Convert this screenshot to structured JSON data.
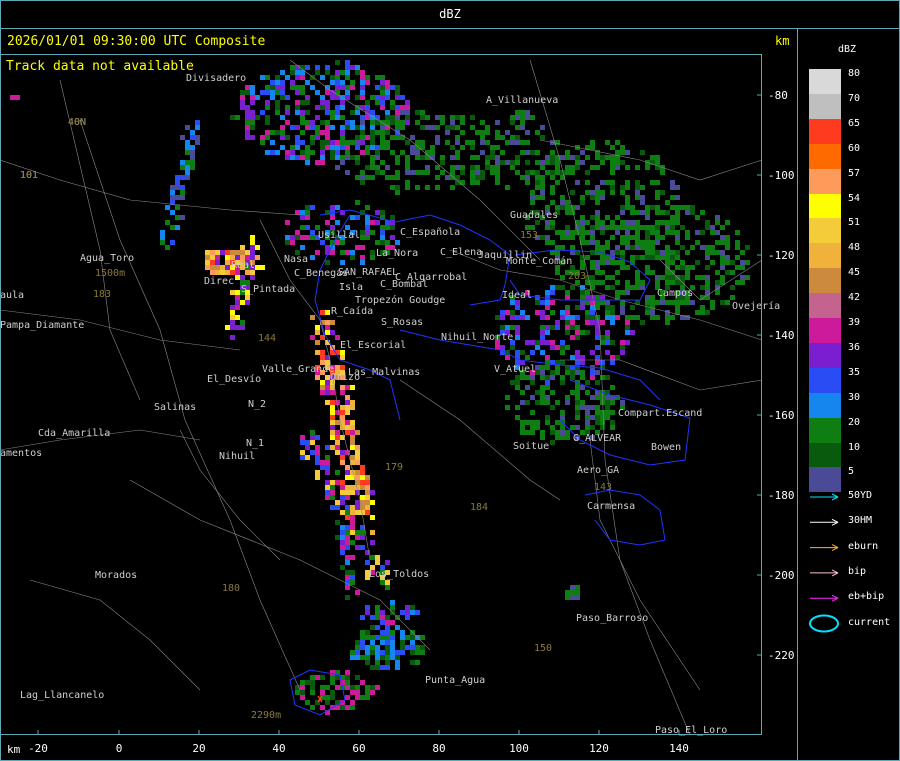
{
  "title": "dBZ",
  "header": {
    "timestamp": "2026/01/01 09:30:00 UTC Composite",
    "track_status": "Track data not available",
    "km_label_top": "km",
    "km_label_bottom": "km"
  },
  "axes": {
    "x_ticks": [
      "-20",
      "0",
      "20",
      "40",
      "60",
      "80",
      "100",
      "120",
      "140"
    ],
    "y_ticks": [
      "-80",
      "-100",
      "-120",
      "-140",
      "-160",
      "-180",
      "-200",
      "-220"
    ]
  },
  "legend": {
    "title": "dBZ",
    "levels": [
      {
        "label": "80",
        "color": "#d9d9d9"
      },
      {
        "label": "70",
        "color": "#bfbfbf"
      },
      {
        "label": "65",
        "color": "#ff3b1f"
      },
      {
        "label": "60",
        "color": "#ff6a00"
      },
      {
        "label": "57",
        "color": "#ff9b5a"
      },
      {
        "label": "54",
        "color": "#ffff00"
      },
      {
        "label": "51",
        "color": "#f4cc3a"
      },
      {
        "label": "48",
        "color": "#f0b23a"
      },
      {
        "label": "45",
        "color": "#cc8a3c"
      },
      {
        "label": "42",
        "color": "#c4648e"
      },
      {
        "label": "39",
        "color": "#cc1a9a"
      },
      {
        "label": "36",
        "color": "#7a1fd0"
      },
      {
        "label": "35",
        "color": "#2a4cf5"
      },
      {
        "label": "30",
        "color": "#1486ee"
      },
      {
        "label": "20",
        "color": "#0e7e12"
      },
      {
        "label": "10",
        "color": "#0a5a0e"
      },
      {
        "label": "5",
        "color": "#4a4a96"
      }
    ],
    "tracks": [
      {
        "label": "50YD",
        "color": "#00e5ff"
      },
      {
        "label": "30HM",
        "color": "#ffffff"
      },
      {
        "label": "eburn",
        "color": "#ffb23a"
      },
      {
        "label": "bip",
        "color": "#ffc0cb"
      },
      {
        "label": "eb+bip",
        "color": "#ff2bff"
      },
      {
        "label": "current",
        "color": "#00e5ff"
      }
    ]
  },
  "places": [
    {
      "name": "Divisadero"
    },
    {
      "name": "A_Villanueva"
    },
    {
      "name": "40N"
    },
    {
      "name": "101"
    },
    {
      "name": "Guadales"
    },
    {
      "name": "Usillal"
    },
    {
      "name": "Monte_Comán"
    },
    {
      "name": "C_Española"
    },
    {
      "name": "La_Nora"
    },
    {
      "name": "C_Elena"
    },
    {
      "name": "Jaquillin"
    },
    {
      "name": "Agua_Toro"
    },
    {
      "name": "C_Benegas"
    },
    {
      "name": "SAN_RAFAEL"
    },
    {
      "name": "C_Algarrobal"
    },
    {
      "name": "C_Bombal"
    },
    {
      "name": "S_Pintada"
    },
    {
      "name": "Tropezón Goudge"
    },
    {
      "name": "Ovejería"
    },
    {
      "name": "R_Caída"
    },
    {
      "name": "S_Rosas"
    },
    {
      "name": "Pampa_Diamante"
    },
    {
      "name": "Nihuil_Norte"
    },
    {
      "name": "El_Escorial"
    },
    {
      "name": "El_Desvío"
    },
    {
      "name": "Valle_Grande"
    },
    {
      "name": "Las_Malvinas"
    },
    {
      "name": "V_Atuel"
    },
    {
      "name": "Salinas"
    },
    {
      "name": "Cda_Amarilla"
    },
    {
      "name": "Compart.Escand"
    },
    {
      "name": "Soitue"
    },
    {
      "name": "G_ALVEAR"
    },
    {
      "name": "Bowen"
    },
    {
      "name": "Nihuil"
    },
    {
      "name": "Aero_GA"
    },
    {
      "name": "Carmensa"
    },
    {
      "name": "Morados"
    },
    {
      "name": "Los_Toldos"
    },
    {
      "name": "Paso_Barroso"
    },
    {
      "name": "Punta_Agua"
    },
    {
      "name": "Lag_Llancanelo"
    },
    {
      "name": "Paso_El_Loro"
    },
    {
      "name": "Real"
    },
    {
      "name": "Nasa"
    },
    {
      "name": "Isla"
    },
    {
      "name": "Ideal"
    },
    {
      "name": "Campos"
    },
    {
      "name": "Orizo"
    },
    {
      "name": "N_2"
    },
    {
      "name": "N_1"
    },
    {
      "name": "amentos"
    },
    {
      "name": "aula"
    },
    {
      "name": "Direc"
    }
  ],
  "roads": [
    "40N",
    "101",
    "144",
    "143",
    "179",
    "184",
    "180",
    "183",
    "153",
    "203",
    "150",
    "2290m",
    "1500m"
  ]
}
